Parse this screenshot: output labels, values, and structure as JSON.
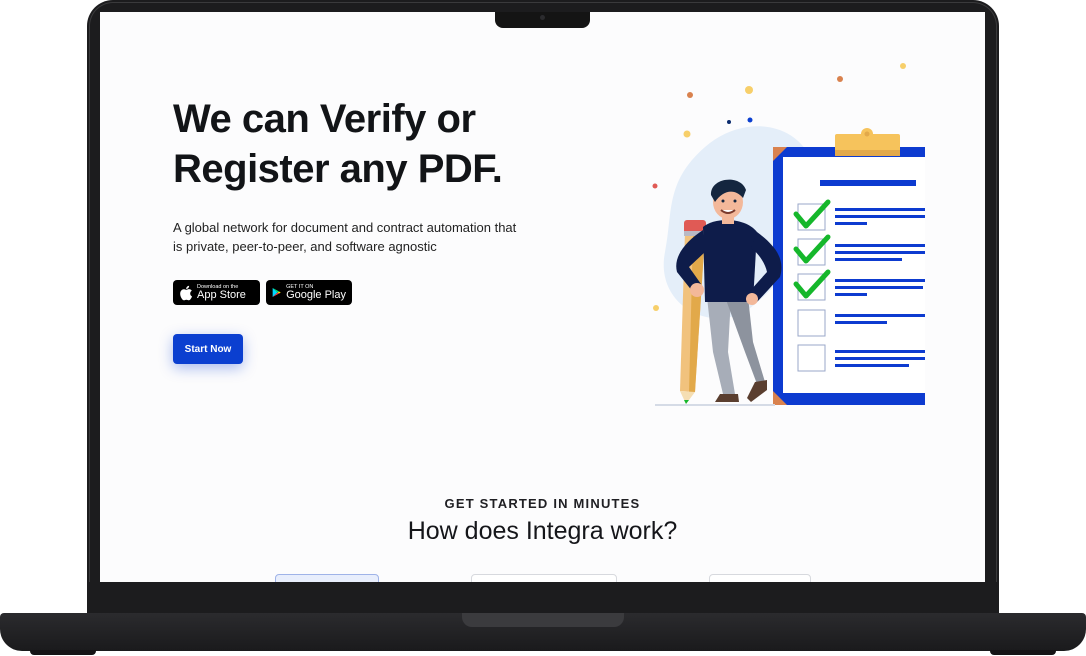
{
  "hero": {
    "title_line1": "We can Verify or",
    "title_line2": "Register any PDF.",
    "subtitle_line1": "A global network for document and contract automation that",
    "subtitle_line2": "is private, peer-to-peer, and software agnostic"
  },
  "badges": {
    "app_store_small": "Download on the",
    "app_store_big": "App Store",
    "google_play_small": "GET IT ON",
    "google_play_big": "Google Play"
  },
  "cta": {
    "label": "Start Now"
  },
  "section": {
    "eyebrow": "GET STARTED IN MINUTES",
    "title": "How does Integra work?"
  },
  "colors": {
    "primary": "#0b3fd0",
    "check": "#15b72b",
    "clipboard_blue": "#0d3bd0",
    "clip_gold": "#f6c35c"
  },
  "icons": [
    "apple-icon",
    "google-play-icon",
    "checkmark-icon"
  ]
}
